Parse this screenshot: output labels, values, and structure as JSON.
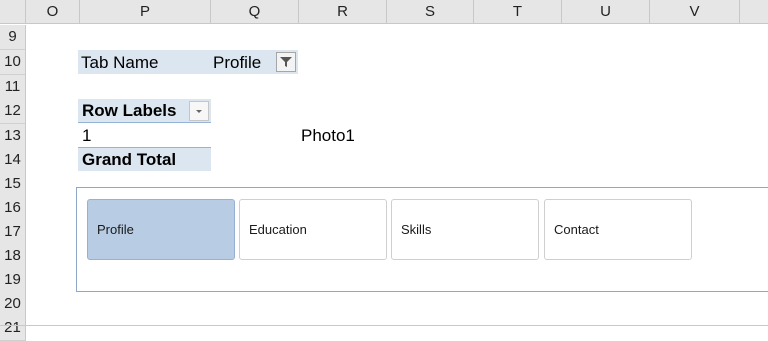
{
  "columns": [
    "O",
    "P",
    "Q",
    "R",
    "S",
    "T",
    "U",
    "V"
  ],
  "rows": [
    "9",
    "10",
    "11",
    "12",
    "13",
    "14",
    "15",
    "16",
    "17",
    "18",
    "19",
    "20",
    "21"
  ],
  "pivot_filter": {
    "label": "Tab Name",
    "value": "Profile"
  },
  "pivot_table": {
    "header": "Row Labels",
    "row_label": "1",
    "row_value": "Photo1",
    "total_label": "Grand Total"
  },
  "slicer": {
    "items": [
      {
        "label": "Profile",
        "selected": true
      },
      {
        "label": "Education",
        "selected": false
      },
      {
        "label": "Skills",
        "selected": false
      },
      {
        "label": "Contact",
        "selected": false
      }
    ]
  },
  "colors": {
    "pivot_band": "#dce6f1",
    "slicer_selected": "#b8cce4",
    "slicer_border": "#8ea9c8"
  },
  "icons": {
    "filter": "filter-funnel-icon",
    "dropdown": "dropdown-arrow-icon"
  }
}
